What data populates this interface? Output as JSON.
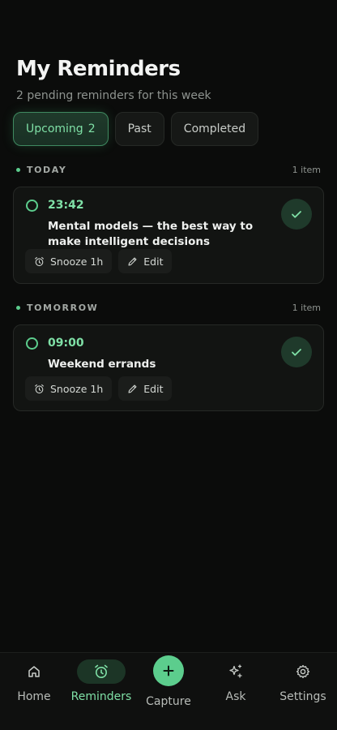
{
  "header": {
    "title": "My Reminders",
    "subtitle": "2 pending reminders for this week"
  },
  "tabs": [
    {
      "label": "Upcoming",
      "count": "2",
      "active": true
    },
    {
      "label": "Past"
    },
    {
      "label": "Completed"
    }
  ],
  "sections": [
    {
      "label": "TODAY",
      "count": "1 item",
      "reminders": [
        {
          "time": "23:42",
          "text": "Mental models — the best way to make intelligent decisions",
          "snooze_label": "Snooze 1h",
          "edit_label": "Edit"
        }
      ]
    },
    {
      "label": "TOMORROW",
      "count": "1 item",
      "reminders": [
        {
          "time": "09:00",
          "text": "Weekend errands",
          "snooze_label": "Snooze 1h",
          "edit_label": "Edit"
        }
      ]
    }
  ],
  "nav": [
    {
      "label": "Home",
      "icon": "home-icon"
    },
    {
      "label": "Reminders",
      "icon": "alarm-clock-icon",
      "active": true
    },
    {
      "label": "Capture",
      "icon": "plus-icon"
    },
    {
      "label": "Ask",
      "icon": "sparkles-icon"
    },
    {
      "label": "Settings",
      "icon": "gear-icon"
    }
  ],
  "colors": {
    "accent": "#5ccd8d",
    "accent_text": "#7fe0a6",
    "background": "#0b0c0b",
    "card": "#121412"
  }
}
